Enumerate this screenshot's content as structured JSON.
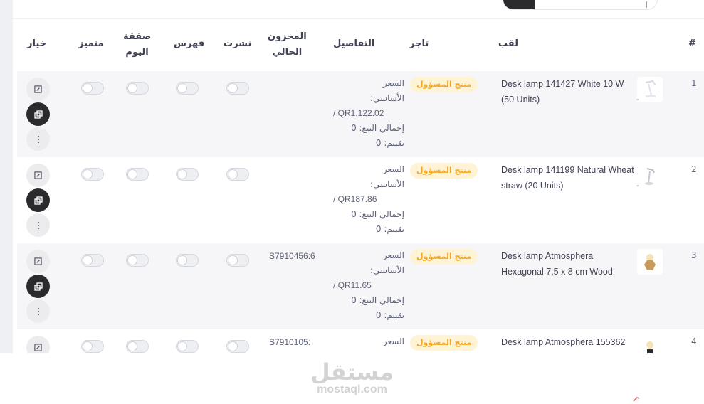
{
  "search": {
    "button_icon": "search-icon",
    "input_value": ""
  },
  "columns": {
    "num": "#",
    "title": "لقب",
    "merchant": "تاجر",
    "details": "التفاصيل",
    "stock_line1": "المخزون",
    "stock_line2": "الحالي",
    "published": "نشرت",
    "index": "فهرس",
    "deal_line1": "صفقة",
    "deal_line2": "اليوم",
    "featured": "متميز",
    "option": "خيار"
  },
  "rows": [
    {
      "num": "1",
      "title": "Desk lamp 141427 White 10 W (50 Units)",
      "thumb_dash": "-",
      "merchant_badge": "منتج المسؤول",
      "details_price_label1": "السعر",
      "details_price_label2": "الأساسي:",
      "details_price": "/ QR1,122.02",
      "details_sales": "إجمالي البيع: 0",
      "details_rating": "تقييم: 0",
      "sku": "",
      "published": false,
      "index": false,
      "deal": false,
      "featured": false
    },
    {
      "num": "2",
      "title": "Desk lamp 141199 Natural Wheat straw (20 Units)",
      "thumb_dash": "-",
      "merchant_badge": "منتج المسؤول",
      "details_price_label1": "السعر",
      "details_price_label2": "الأساسي:",
      "details_price": "/ QR187.86",
      "details_sales": "إجمالي البيع: 0",
      "details_rating": "تقييم: 0",
      "sku": "",
      "published": false,
      "index": false,
      "deal": false,
      "featured": false
    },
    {
      "num": "3",
      "title": "Desk lamp Atmosphera Hexagonal 7,5 x 8 cm Wood",
      "thumb_dash": "",
      "merchant_badge": "منتج المسؤول",
      "details_price_label1": "السعر",
      "details_price_label2": "الأساسي:",
      "details_price": "/ QR11.65",
      "details_sales": "إجمالي البيع: 0",
      "details_rating": "تقييم: 0",
      "sku": "S7910456:6",
      "published": false,
      "index": false,
      "deal": false,
      "featured": false
    },
    {
      "num": "4",
      "title": "Desk lamp Atmosphera 155362",
      "thumb_dash": "",
      "merchant_badge": "منتج المسؤول",
      "details_price_label1": "السعر",
      "details_price_label2": "",
      "details_price": "",
      "details_sales": "",
      "details_rating": "",
      "sku": "S7910105:",
      "published": false,
      "index": false,
      "deal": false,
      "featured": false
    }
  ],
  "actions": {
    "edit_icon": "edit-icon",
    "copy_icon": "copy-icon",
    "more_icon": "more-vertical-icon"
  },
  "watermark": {
    "logo_text": "مستقل",
    "domain": "mostaql.com"
  },
  "colors": {
    "badge_bg": "#fff3d6",
    "badge_text": "#f5a623",
    "dark_action": "#2b2b2e",
    "row_alt": "#f6f6f8"
  }
}
